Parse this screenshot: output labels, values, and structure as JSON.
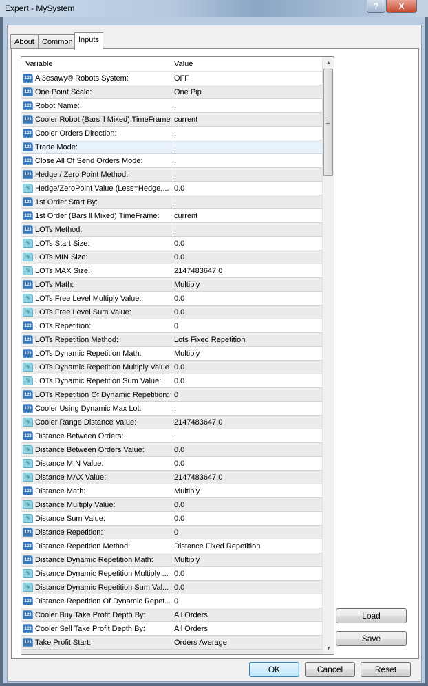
{
  "window": {
    "title": "Expert - MySystem",
    "help_label": "?",
    "close_label": "X"
  },
  "tabs": [
    {
      "label": "About"
    },
    {
      "label": "Common"
    },
    {
      "label": "Inputs",
      "active": true
    }
  ],
  "grid": {
    "columns": [
      "Variable",
      "Value"
    ],
    "rows": [
      {
        "type": "int",
        "name": "Al3esawy® Robots System:",
        "value": "OFF"
      },
      {
        "type": "int",
        "name": "One Point Scale:",
        "value": "One Pip"
      },
      {
        "type": "int",
        "name": "Robot Name:",
        "value": "."
      },
      {
        "type": "int",
        "name": "Cooler Robot (Bars ‖ Mixed) TimeFrame:",
        "value": "current"
      },
      {
        "type": "int",
        "name": "Cooler Orders Direction:",
        "value": "."
      },
      {
        "type": "int",
        "name": "Trade Mode:",
        "value": ".",
        "selected": true
      },
      {
        "type": "int",
        "name": "Close All Of Send Orders Mode:",
        "value": "."
      },
      {
        "type": "int",
        "name": "Hedge / Zero Point Method:",
        "value": "."
      },
      {
        "type": "double",
        "name": "Hedge/ZeroPoint Value (Less=Hedge,...",
        "value": "0.0"
      },
      {
        "type": "int",
        "name": "1st Order Start By:",
        "value": "."
      },
      {
        "type": "int",
        "name": "1st Order (Bars ‖ Mixed) TimeFrame:",
        "value": "current"
      },
      {
        "type": "int",
        "name": "LOTs Method:",
        "value": "."
      },
      {
        "type": "double",
        "name": "LOTs Start Size:",
        "value": "0.0"
      },
      {
        "type": "double",
        "name": "LOTs MIN Size:",
        "value": "0.0"
      },
      {
        "type": "double",
        "name": "LOTs MAX Size:",
        "value": "2147483647.0"
      },
      {
        "type": "int",
        "name": "LOTs Math:",
        "value": "Multiply"
      },
      {
        "type": "double",
        "name": "LOTs Free Level Multiply Value:",
        "value": "0.0"
      },
      {
        "type": "double",
        "name": "LOTs Free Level Sum Value:",
        "value": "0.0"
      },
      {
        "type": "int",
        "name": "LOTs Repetition:",
        "value": "0"
      },
      {
        "type": "int",
        "name": "LOTs Repetition Method:",
        "value": "Lots Fixed Repetition"
      },
      {
        "type": "int",
        "name": "LOTs Dynamic Repetition Math:",
        "value": "Multiply"
      },
      {
        "type": "double",
        "name": "LOTs Dynamic Repetition Multiply Value:",
        "value": "0.0"
      },
      {
        "type": "double",
        "name": "LOTs Dynamic Repetition Sum Value:",
        "value": "0.0"
      },
      {
        "type": "int",
        "name": "LOTs Repetition Of Dynamic Repetition:",
        "value": "0"
      },
      {
        "type": "int",
        "name": "Cooler Using Dynamic Max Lot:",
        "value": "."
      },
      {
        "type": "double",
        "name": "Cooler Range Distance Value:",
        "value": "2147483647.0"
      },
      {
        "type": "int",
        "name": "Distance Between Orders:",
        "value": "."
      },
      {
        "type": "double",
        "name": "Distance Between Orders Value:",
        "value": "0.0"
      },
      {
        "type": "double",
        "name": "Distance MIN Value:",
        "value": "0.0"
      },
      {
        "type": "double",
        "name": "Distance MAX Value:",
        "value": "2147483647.0"
      },
      {
        "type": "int",
        "name": "Distance Math:",
        "value": "Multiply"
      },
      {
        "type": "double",
        "name": "Distance Multiply Value:",
        "value": "0.0"
      },
      {
        "type": "double",
        "name": "Distance Sum Value:",
        "value": "0.0"
      },
      {
        "type": "int",
        "name": "Distance Repetition:",
        "value": "0"
      },
      {
        "type": "int",
        "name": "Distance Repetition Method:",
        "value": "Distance Fixed Repetition"
      },
      {
        "type": "int",
        "name": "Distance Dynamic Repetition Math:",
        "value": "Multiply"
      },
      {
        "type": "double",
        "name": "Distance Dynamic Repetition Multiply ...",
        "value": "0.0"
      },
      {
        "type": "double",
        "name": "Distance Dynamic Repetition Sum Val...",
        "value": "0.0"
      },
      {
        "type": "int",
        "name": "Distance Repetition Of Dynamic Repet...",
        "value": "0"
      },
      {
        "type": "int",
        "name": "Cooler Buy Take Profit Depth By:",
        "value": "All Orders"
      },
      {
        "type": "int",
        "name": "Cooler Sell Take Profit Depth By:",
        "value": "All Orders"
      },
      {
        "type": "int",
        "name": "Take Profit Start:",
        "value": "Orders Average"
      }
    ]
  },
  "icons": {
    "int": {
      "name": "integer-type-icon",
      "glyph": "123"
    },
    "double": {
      "name": "double-type-icon",
      "glyph": "½"
    }
  },
  "side_buttons": {
    "load": "Load",
    "save": "Save"
  },
  "footer": {
    "ok": "OK",
    "cancel": "Cancel",
    "reset": "Reset"
  }
}
